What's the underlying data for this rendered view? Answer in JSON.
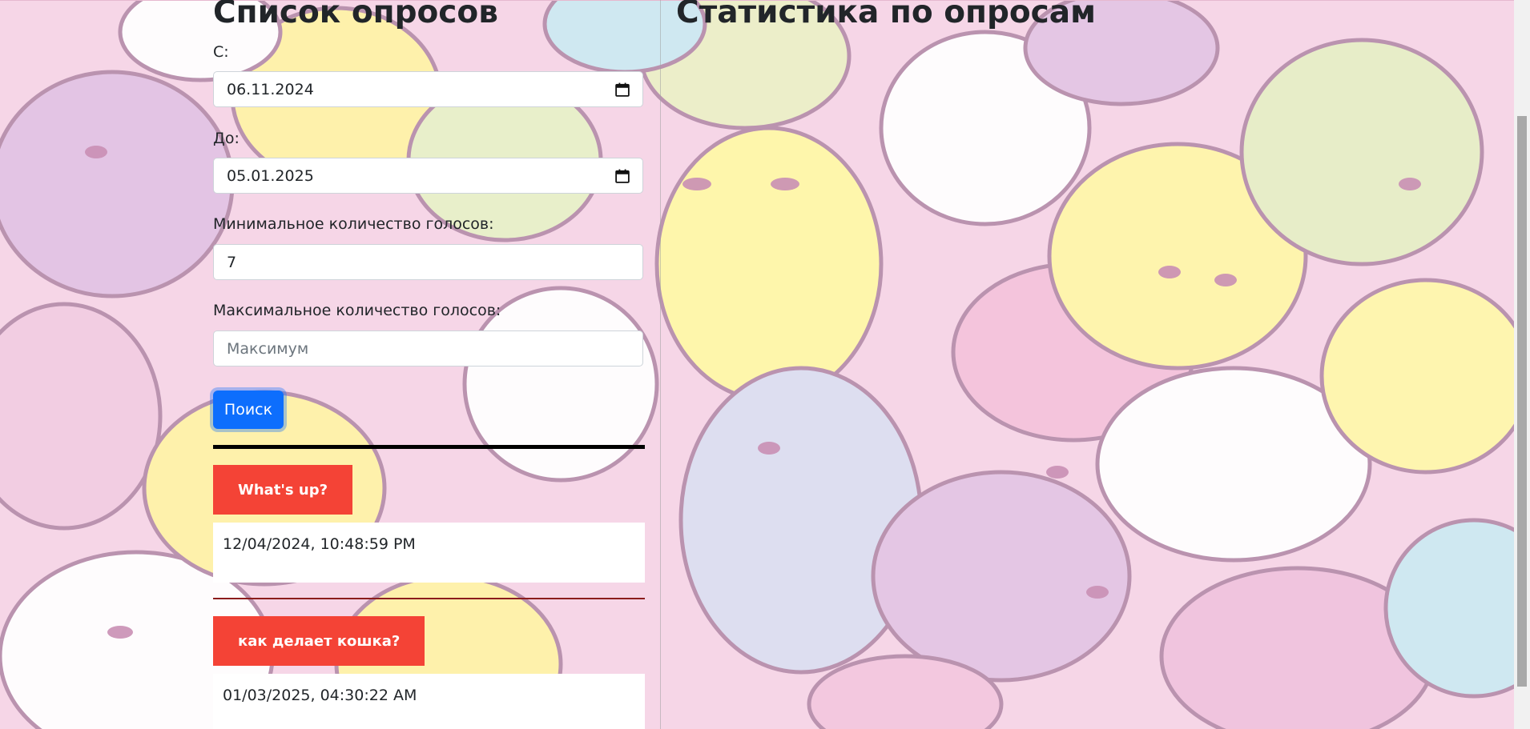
{
  "left": {
    "title": "Список опросов",
    "from_label": "С:",
    "from_value": "06.11.2024",
    "to_label": "До:",
    "to_value": "05.01.2025",
    "min_label": "Минимальное количество голосов:",
    "min_value": "7",
    "max_label": "Максимальное количество голосов:",
    "max_placeholder": "Максимум",
    "search_label": "Поиск",
    "polls": [
      {
        "title": "What's up?",
        "date": "12/04/2024, 10:48:59 PM"
      },
      {
        "title": "как делает кошка?",
        "date": "01/03/2025, 04:30:22 AM"
      }
    ]
  },
  "right": {
    "title": "Статистика по опросам"
  },
  "colors": {
    "primary": "#0d6efd",
    "poll_title_bg": "#f44336",
    "divider_dark": "#8b1c1c"
  },
  "icons": [
    "calendar-icon"
  ]
}
